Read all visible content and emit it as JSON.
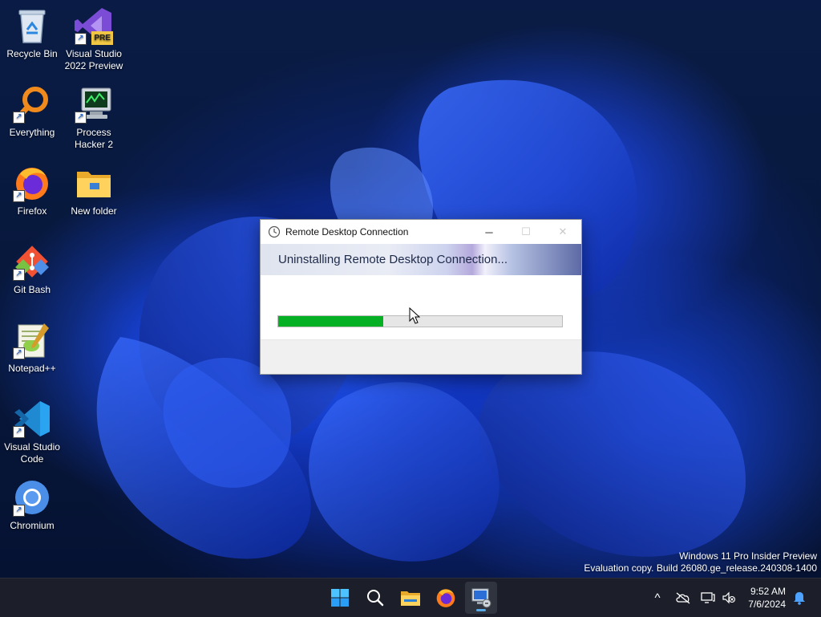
{
  "desktop": {
    "icons": [
      {
        "label": "Recycle Bin",
        "icon": "recycle-bin-icon"
      },
      {
        "label": "Visual Studio 2022 Preview",
        "icon": "visual-studio-icon",
        "badge": "PRE"
      },
      {
        "label": "Everything",
        "icon": "everything-search-icon"
      },
      {
        "label": "Process Hacker 2",
        "icon": "process-hacker-icon"
      },
      {
        "label": "Firefox",
        "icon": "firefox-icon"
      },
      {
        "label": "New folder",
        "icon": "folder-icon"
      },
      {
        "label": "Git Bash",
        "icon": "git-bash-icon"
      },
      {
        "label": "Notepad++",
        "icon": "notepad-plus-plus-icon"
      },
      {
        "label": "Visual Studio Code",
        "icon": "vscode-icon"
      },
      {
        "label": "Chromium",
        "icon": "chromium-icon"
      }
    ]
  },
  "dialog": {
    "title": "Remote Desktop Connection",
    "heading": "Uninstalling Remote Desktop Connection...",
    "progress_fraction": 0.37,
    "controls": {
      "minimize": "─",
      "maximize": "☐",
      "close": "✕"
    }
  },
  "watermark": {
    "line1": "Windows 11 Pro Insider Preview",
    "line2": "Evaluation copy. Build 26080.ge_release.240308-1400"
  },
  "taskbar": {
    "apps": [
      "start-icon",
      "search-icon",
      "file-explorer-icon",
      "firefox-icon",
      "remote-desktop-icon"
    ],
    "tray": {
      "chevron": "^"
    },
    "clock": {
      "time": "9:52 AM",
      "date": "7/6/2024"
    }
  },
  "colors": {
    "progress_fill": "#06b025",
    "taskbar": "#1c1f2a",
    "accent": "#58a9e6"
  }
}
